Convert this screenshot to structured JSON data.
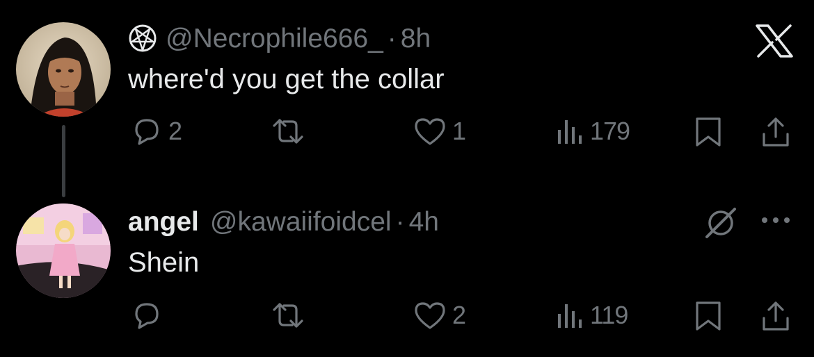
{
  "tweets": [
    {
      "avatar": "avatar-man",
      "badge_icon": "pentagram-icon",
      "name": "",
      "handle": "@Necrophile666_",
      "dot": "·",
      "time": "8h",
      "text": "where'd you get the collar",
      "corner_icon": "x-logo-icon",
      "replies": "2",
      "reposts": "",
      "likes": "1",
      "views": "179"
    },
    {
      "avatar": "avatar-doll",
      "name": "angel",
      "handle": "@kawaiifoidcel",
      "dot": "·",
      "time": "4h",
      "text": "Shein",
      "corner_icon": "grok-icon",
      "more_icon": "more-icon",
      "replies": "",
      "reposts": "",
      "likes": "2",
      "views": "119"
    }
  ],
  "colors": {
    "background": "#000000",
    "text": "#e7e9ea",
    "muted": "#71767b",
    "thread_line": "#3a3d40"
  }
}
